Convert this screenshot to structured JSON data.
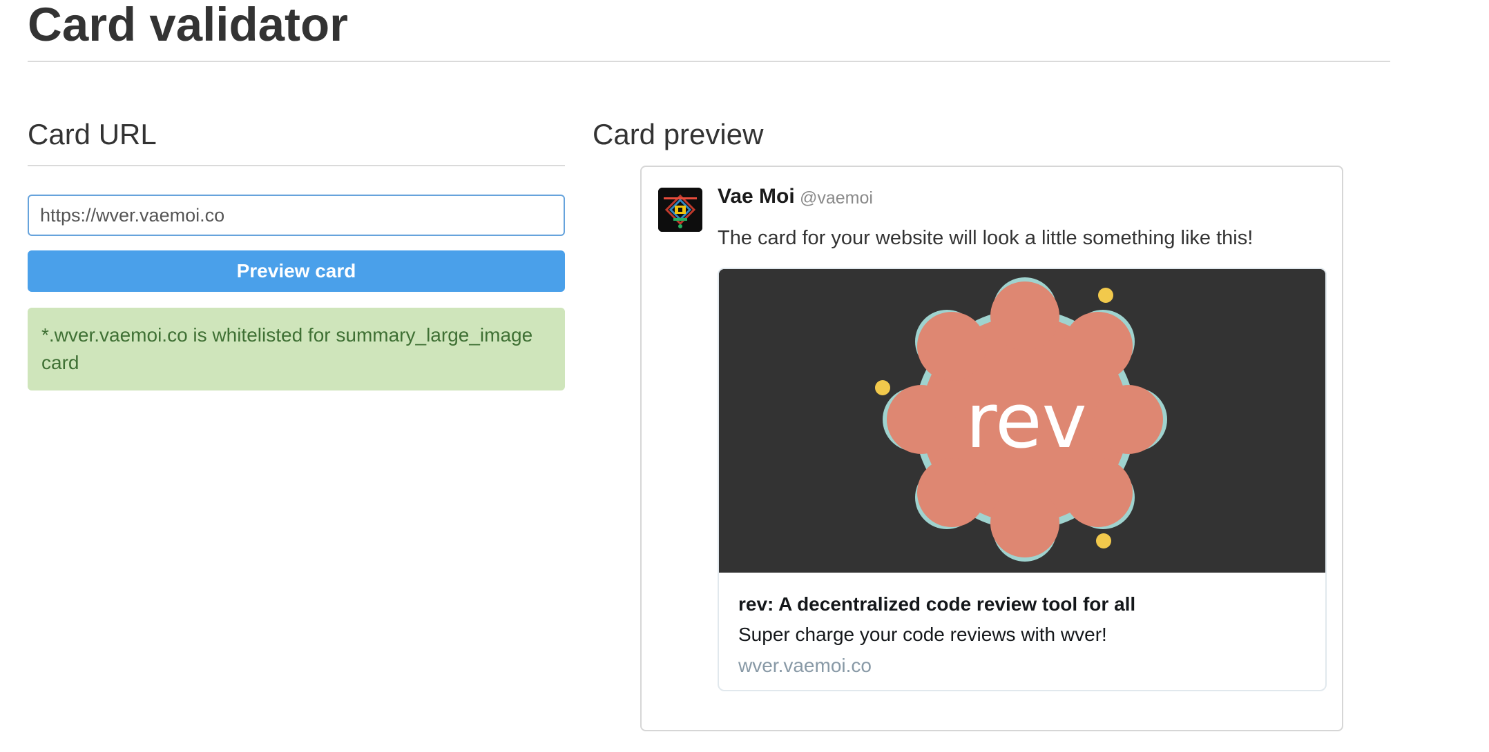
{
  "page": {
    "title": "Card validator"
  },
  "card_url": {
    "heading": "Card URL",
    "input_value": "https://wver.vaemoi.co",
    "button_label": "Preview card",
    "status_message": "*.wver.vaemoi.co is whitelisted for summary_large_image card"
  },
  "card_preview": {
    "heading": "Card preview",
    "tweet": {
      "author_name": "Vae Moi",
      "author_handle": "@vaemoi",
      "text": "The card for your website will look a little something like this!"
    },
    "card": {
      "image_text": "rev",
      "title": "rev: A decentralized code review tool for all",
      "description": "Super charge your code reviews with wver!",
      "domain": "wver.vaemoi.co"
    }
  },
  "colors": {
    "button": "#4aa0ea",
    "alert_bg": "#cfe5bb",
    "alert_text": "#3f7034",
    "input_border": "#66a3dc",
    "card_image_bg": "#333333",
    "badge_fill": "#de8772",
    "badge_petal": "#9fd3cf",
    "sparkle": "#f2c94c"
  },
  "icons": {
    "avatar": "pixel-logo-avatar"
  }
}
